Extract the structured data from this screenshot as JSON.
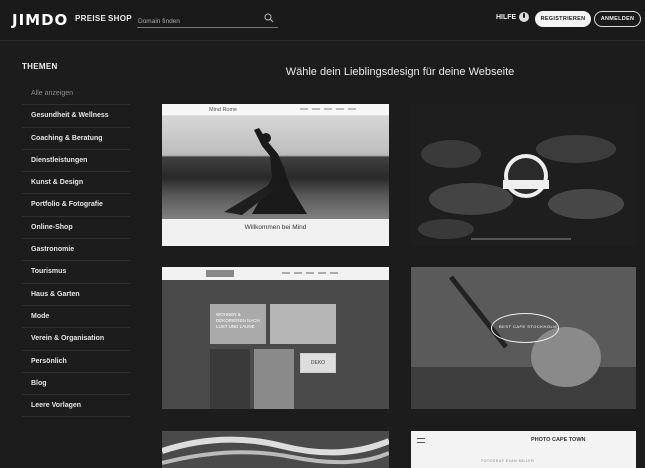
{
  "header": {
    "logo": "JIMDO",
    "nav": [
      "PREISE",
      "SHOP"
    ],
    "search_placeholder": "Domain finden",
    "help_label": "HILFE",
    "register_label": "REGISTRIEREN",
    "login_label": "ANMELDEN"
  },
  "sidebar": {
    "title": "THEMEN",
    "items": [
      {
        "label": "Alle anzeigen",
        "active": true
      },
      {
        "label": "Gesundheit & Wellness"
      },
      {
        "label": "Coaching & Beratung"
      },
      {
        "label": "Dienstleistungen"
      },
      {
        "label": "Kunst & Design"
      },
      {
        "label": "Portfolio & Fotografie"
      },
      {
        "label": "Online-Shop"
      },
      {
        "label": "Gastronomie"
      },
      {
        "label": "Tourismus"
      },
      {
        "label": "Haus & Garten"
      },
      {
        "label": "Mode"
      },
      {
        "label": "Verein & Organisation"
      },
      {
        "label": "Persönlich"
      },
      {
        "label": "Blog"
      },
      {
        "label": "Leere Vorlagen"
      }
    ]
  },
  "main": {
    "heading": "Wähle dein Lieblingsdesign für deine Webseite",
    "templates": {
      "mind_logo": "Mind Rome",
      "mind_caption": "Willkommen bei Mind",
      "poster_text": "WOHNEN & DEKORIEREN NACH LUST UND LAUNE",
      "deko_label": "DEKO",
      "cafe_badge": "BEST CAFE STOCKHOLM",
      "photo_brand": "PHOTO CAPE TOWN",
      "photo_sub": "FOTOGRAF EVAN MILLER"
    }
  },
  "colors": {
    "background": "#1c1c1c",
    "header": "#1a1a1a",
    "register_bg": "#f4f4f4"
  }
}
